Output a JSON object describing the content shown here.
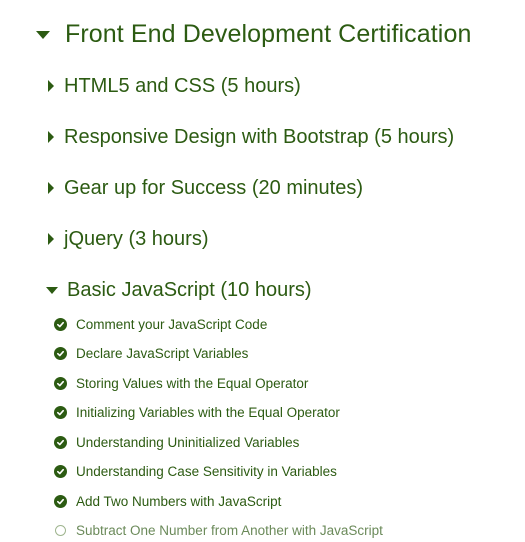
{
  "certification": {
    "title": "Front End Development Certification",
    "expanded": true
  },
  "sections": [
    {
      "label": "HTML5 and CSS (5 hours)",
      "expanded": false
    },
    {
      "label": "Responsive Design with Bootstrap (5 hours)",
      "expanded": false
    },
    {
      "label": "Gear up for Success (20 minutes)",
      "expanded": false
    },
    {
      "label": "jQuery (3 hours)",
      "expanded": false
    },
    {
      "label": "Basic JavaScript (10 hours)",
      "expanded": true
    }
  ],
  "lessons": [
    {
      "label": "Comment your JavaScript Code",
      "completed": true
    },
    {
      "label": "Declare JavaScript Variables",
      "completed": true
    },
    {
      "label": "Storing Values with the Equal Operator",
      "completed": true
    },
    {
      "label": "Initializing Variables with the Equal Operator",
      "completed": true
    },
    {
      "label": "Understanding Uninitialized Variables",
      "completed": true
    },
    {
      "label": "Understanding Case Sensitivity in Variables",
      "completed": true
    },
    {
      "label": "Add Two Numbers with JavaScript",
      "completed": true
    },
    {
      "label": "Subtract One Number from Another with JavaScript",
      "completed": false
    }
  ],
  "colors": {
    "accent": "#2c5b12",
    "incomplete_ring": "#9fb58f",
    "background": "#ffffff"
  },
  "icons": {
    "expanded": "caret-down-icon",
    "collapsed": "caret-right-icon",
    "completed": "check-circle-icon",
    "incomplete": "empty-circle-icon"
  }
}
